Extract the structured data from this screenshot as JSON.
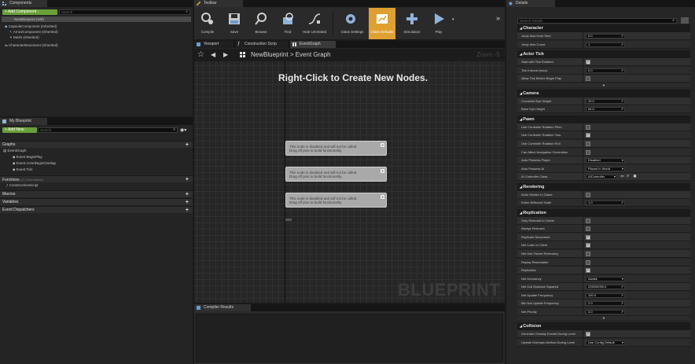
{
  "components": {
    "tab": "Components",
    "add_button": "+ Add Component -",
    "search_placeholder": "Search",
    "root": "NewBlueprint (self)",
    "items": [
      "CapsuleComponent (Inherited)",
      "ArrowComponent (Inherited)",
      "Mesh (Inherited)",
      "CharacterMovement (Inherited)"
    ]
  },
  "my_blueprint": {
    "tab": "My Blueprint",
    "add_button": "+ Add New -",
    "search_placeholder": "Search",
    "graphs_label": "Graphs",
    "event_graph": "EventGraph",
    "events": [
      "Event BeginPlay",
      "Event ActorBeginOverlap",
      "Event Tick"
    ],
    "functions_label": "Functions",
    "functions_count": "(21 Overridable)",
    "construction_script": "ConstructionScript",
    "macros_label": "Macros",
    "variables_label": "Variables",
    "dispatchers_label": "Event Dispatchers"
  },
  "toolbar": {
    "tab": "Toolbar",
    "buttons": [
      {
        "label": "Compile",
        "icon": "compile-icon"
      },
      {
        "label": "Save",
        "icon": "save-icon"
      },
      {
        "label": "Browse",
        "icon": "browse-icon"
      },
      {
        "label": "Find",
        "icon": "find-icon"
      },
      {
        "label": "Hide Unrelated",
        "icon": "hide-unrelated-icon"
      },
      {
        "label": "Class Settings",
        "icon": "class-settings-icon"
      },
      {
        "label": "Class Defaults",
        "icon": "class-defaults-icon"
      },
      {
        "label": "Simulation",
        "icon": "simulation-icon"
      },
      {
        "label": "Play",
        "icon": "play-icon"
      }
    ]
  },
  "editor_tabs": [
    "Viewport",
    "Construction Scrip",
    "EventGraph"
  ],
  "graph": {
    "breadcrumb_root": "NewBlueprint",
    "breadcrumb_sep": ">",
    "breadcrumb_current": "Event Graph",
    "zoom": "Zoom -5",
    "hint": "Right-Click to Create New Nodes.",
    "watermark": "BLUEPRINT",
    "nodes": [
      {
        "line1": "This node is disabled and will not be called.",
        "line2": "Drag off pins to build functionality."
      },
      {
        "line1": "This node is disabled and will not be called.",
        "line2": "Drag off pins to build functionality."
      },
      {
        "line1": "This node is disabled and will not be called.",
        "line2": "Drag off pins to build functionality."
      }
    ]
  },
  "compiler": {
    "tab": "Compiler Results"
  },
  "details": {
    "tab": "Details",
    "search_placeholder": "Search Details",
    "sections": [
      {
        "title": "Character",
        "rows": [
          {
            "label": "Jump Max Hold Time",
            "type": "num",
            "value": "0.0"
          },
          {
            "label": "Jump Max Count",
            "type": "num",
            "value": "1"
          }
        ]
      },
      {
        "title": "Actor Tick",
        "rows": [
          {
            "label": "Start with Tick Enabled",
            "type": "check",
            "value": true
          },
          {
            "label": "Tick Interval (secs)",
            "type": "num",
            "value": "0.0"
          },
          {
            "label": "Allow Tick Before Begin Play",
            "type": "check",
            "value": false
          }
        ]
      },
      {
        "title": "Camera",
        "rows": [
          {
            "label": "Crouched Eye Height",
            "type": "num",
            "value": "32.0"
          },
          {
            "label": "Base Eye Height",
            "type": "num",
            "value": "64.0"
          }
        ]
      },
      {
        "title": "Pawn",
        "rows": [
          {
            "label": "Use Controller Rotation Pitch",
            "type": "check",
            "value": false
          },
          {
            "label": "Use Controller Rotation Yaw",
            "type": "check",
            "value": true
          },
          {
            "label": "Use Controller Rotation Roll",
            "type": "check",
            "value": false
          },
          {
            "label": "Can Affect Navigation Generation",
            "type": "check",
            "value": false
          },
          {
            "label": "Auto Possess Player",
            "type": "select",
            "value": "Disabled"
          },
          {
            "label": "Auto Possess AI",
            "type": "select",
            "value": "Placed in World"
          },
          {
            "label": "AI Controller Class",
            "type": "class",
            "value": "AIController"
          }
        ]
      },
      {
        "title": "Rendering",
        "rows": [
          {
            "label": "Actor Hidden In Game",
            "type": "check",
            "value": false
          },
          {
            "label": "Editor Billboard Scale",
            "type": "num",
            "value": "1.0"
          }
        ]
      },
      {
        "title": "Replication",
        "rows": [
          {
            "label": "Only Relevant to Owner",
            "type": "check",
            "value": false
          },
          {
            "label": "Always Relevant",
            "type": "check",
            "value": false
          },
          {
            "label": "Replicate Movement",
            "type": "check",
            "value": true
          },
          {
            "label": "Net Load on Client",
            "type": "check",
            "value": true
          },
          {
            "label": "Net Use Owner Relevancy",
            "type": "check",
            "value": false
          },
          {
            "label": "Replay Rewindable",
            "type": "check",
            "value": false
          },
          {
            "label": "Replicates",
            "type": "check",
            "value": true
          },
          {
            "label": "Net Dormancy",
            "type": "select",
            "value": "Awake"
          },
          {
            "label": "Net Cull Distance Squared",
            "type": "num",
            "value": "225000000.0"
          },
          {
            "label": "Net Update Frequency",
            "type": "num",
            "value": "100.0"
          },
          {
            "label": "Min Net Update Frequency",
            "type": "num",
            "value": "2.0"
          },
          {
            "label": "Net Priority",
            "type": "num",
            "value": "3.0"
          }
        ]
      },
      {
        "title": "Collision",
        "rows": [
          {
            "label": "Generate Overlap Events During Level",
            "type": "check",
            "value": true
          },
          {
            "label": "Update Overlaps Method During Level",
            "type": "select",
            "value": "Use Config Default"
          }
        ]
      }
    ]
  }
}
